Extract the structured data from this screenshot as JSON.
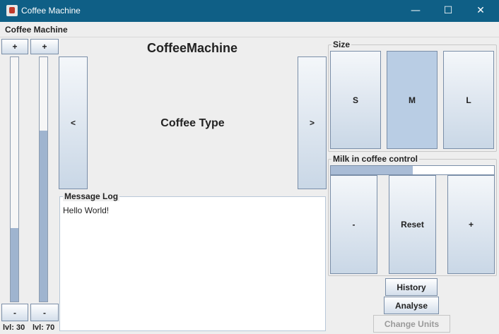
{
  "window": {
    "title": "Coffee Machine",
    "controls": {
      "minimize": "—",
      "maximize": "☐",
      "close": "✕"
    }
  },
  "menu": {
    "title": "Coffee Machine"
  },
  "left_controls": {
    "bar1": {
      "plus": "+",
      "minus": "-",
      "level_label": "lvl: 30",
      "level": 30
    },
    "bar2": {
      "plus": "+",
      "minus": "-",
      "level_label": "lvl: 70",
      "level": 70
    }
  },
  "center": {
    "heading": "CoffeeMachine",
    "prev_button": "<",
    "next_button": ">",
    "coffee_type": "Coffee Type"
  },
  "message_log": {
    "legend": "Message Log",
    "text": "Hello World!"
  },
  "size": {
    "legend": "Size",
    "options": [
      "S",
      "M",
      "L"
    ],
    "selected": "M"
  },
  "milk": {
    "legend": "Milk in coffee control",
    "level_fraction": 0.5,
    "minus": "-",
    "reset": "Reset",
    "plus": "+"
  },
  "actions": {
    "history": "History",
    "analyse": "Analyse",
    "change_units": "Change Units"
  },
  "colors": {
    "titlebar": "#0f5f86",
    "bar_fill": "#9fb4cf",
    "selected": "#b9cde4"
  }
}
